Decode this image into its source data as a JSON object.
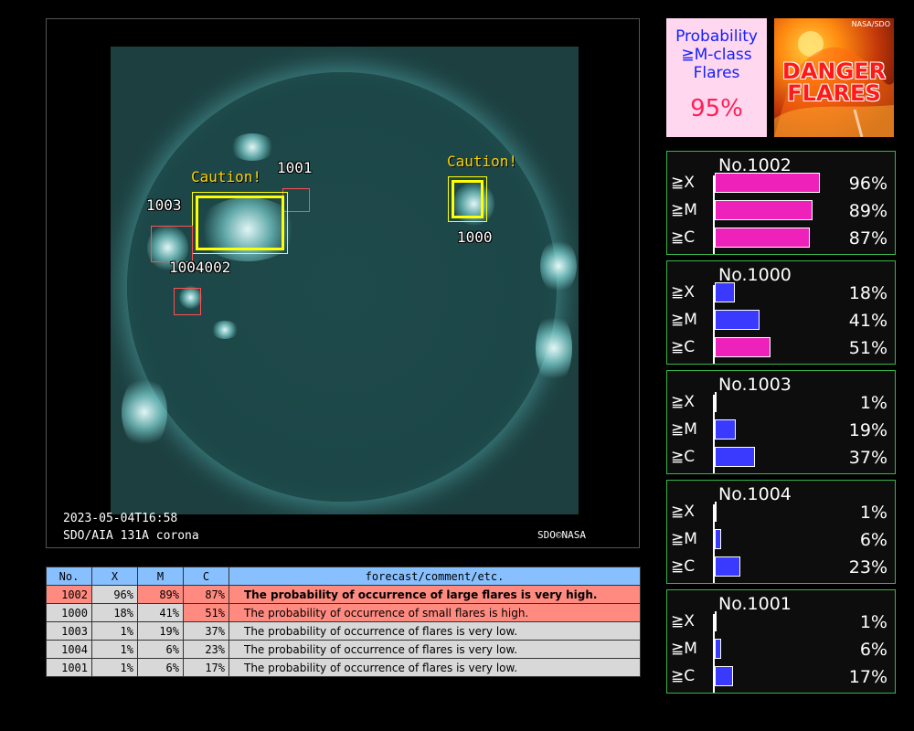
{
  "image_panel": {
    "timestamp": "2023-05-04T16:58",
    "instrument": "SDO/AIA 131A corona",
    "credit": "SDO©NASA",
    "caution_label": "Caution!"
  },
  "regions_on_image": {
    "r1001": "1001",
    "r1003": "1003",
    "r1004002": "1004002",
    "r1000": "1000"
  },
  "table": {
    "headers": [
      "No.",
      "X",
      "M",
      "C",
      "forecast/comment/etc."
    ],
    "rows": [
      {
        "no": "1002",
        "x": "96%",
        "m": "89%",
        "c": "87%",
        "comment": "The probability of occurrence of large flares is very high."
      },
      {
        "no": "1000",
        "x": "18%",
        "m": "41%",
        "c": "51%",
        "comment": "The probability of occurrence of small flares is high."
      },
      {
        "no": "1003",
        "x": "1%",
        "m": "19%",
        "c": "37%",
        "comment": "The probability of occurrence of flares is very low."
      },
      {
        "no": "1004",
        "x": "1%",
        "m": "6%",
        "c": "23%",
        "comment": "The probability of occurrence of flares is very low."
      },
      {
        "no": "1001",
        "x": "1%",
        "m": "6%",
        "c": "17%",
        "comment": "The probability of occurrence of flares is very low."
      }
    ]
  },
  "probability_box": {
    "line1": "Probability",
    "line2": "≧M-class",
    "line3": "Flares",
    "value": "95%"
  },
  "danger_box": {
    "credit": "NASA/SDO",
    "line1": "DANGER",
    "line2": "FLARES"
  },
  "bar_labels": {
    "x": "≧X",
    "m": "≧M",
    "c": "≧C"
  },
  "cards": [
    {
      "title": "No.1002",
      "x": {
        "value": 96,
        "text": "96%"
      },
      "m": {
        "value": 89,
        "text": "89%"
      },
      "c": {
        "value": 87,
        "text": "87%"
      }
    },
    {
      "title": "No.1000",
      "x": {
        "value": 18,
        "text": "18%"
      },
      "m": {
        "value": 41,
        "text": "41%"
      },
      "c": {
        "value": 51,
        "text": "51%"
      }
    },
    {
      "title": "No.1003",
      "x": {
        "value": 1,
        "text": "1%"
      },
      "m": {
        "value": 19,
        "text": "19%"
      },
      "c": {
        "value": 37,
        "text": "37%"
      }
    },
    {
      "title": "No.1004",
      "x": {
        "value": 1,
        "text": "1%"
      },
      "m": {
        "value": 6,
        "text": "6%"
      },
      "c": {
        "value": 23,
        "text": "23%"
      }
    },
    {
      "title": "No.1001",
      "x": {
        "value": 1,
        "text": "1%"
      },
      "m": {
        "value": 6,
        "text": "6%"
      },
      "c": {
        "value": 17,
        "text": "17%"
      }
    }
  ],
  "colors": {
    "high_bar": "#ee22bb",
    "low_bar": "#3a3aff",
    "table_header": "#88c0ff",
    "table_row": "#d8d8d8",
    "table_alert": "#ff8a80",
    "card_border": "#39b54a"
  }
}
